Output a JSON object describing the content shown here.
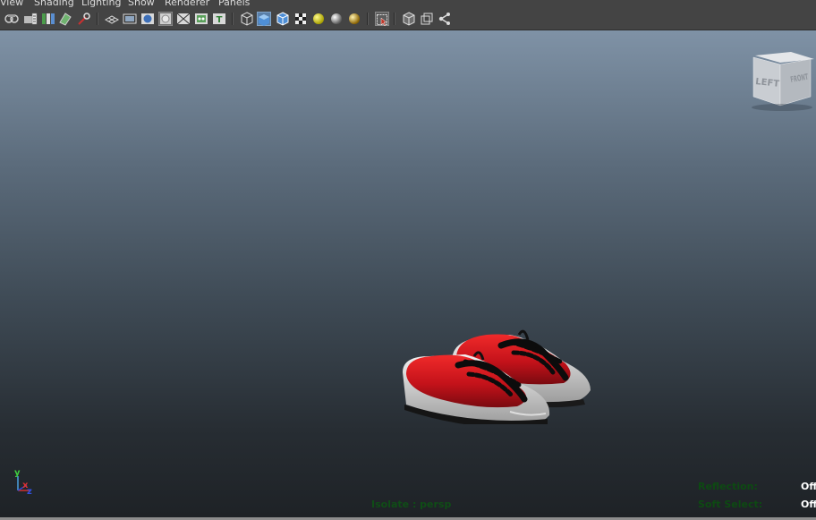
{
  "menubar": {
    "items": [
      "View",
      "Shading",
      "Lighting",
      "Show",
      "Renderer",
      "Panels"
    ]
  },
  "toolbar": {
    "icons": [
      "select-camera-icon",
      "camera-attributes-icon",
      "bookmarks-icon",
      "image-plane-icon",
      "2d-pan-zoom-icon",
      "grease-pencil-icon",
      "grid-icon",
      "film-gate-icon",
      "resolution-gate-icon",
      "gate-mask-icon",
      "field-chart-icon",
      "safe-action-icon",
      "safe-title-icon",
      "wireframe-icon",
      "smooth-shade-icon",
      "wireframe-on-shaded-icon",
      "textured-icon",
      "use-all-lights-icon",
      "shadows-icon",
      "ambient-occlusion-icon",
      "isolate-select-icon",
      "xray-icon",
      "xray-active-components-icon",
      "xray-joints-icon"
    ]
  },
  "viewcube": {
    "left_face": "LEFT",
    "front_face": "FRONT"
  },
  "axis_gizmo": {
    "y": "y",
    "x": "x",
    "z": "z"
  },
  "hud": {
    "isolate": "Isolate : persp",
    "reflection_label": "Reflection:",
    "reflection_value": "Off",
    "soft_select_label": "Soft Select:",
    "soft_select_value": "Off"
  },
  "colors": {
    "shoe_red": "#d0141a",
    "sole_white": "#e6e6e6",
    "lace_black": "#0c0c0c",
    "hud_green": "#0f4d16"
  }
}
